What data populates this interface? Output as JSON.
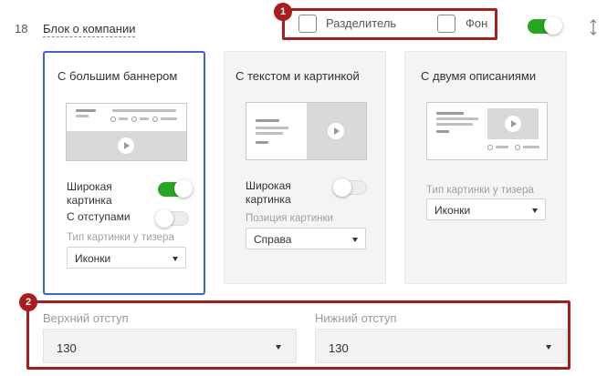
{
  "row": {
    "number": "18",
    "title": "Блок о компании"
  },
  "checkboxes": [
    {
      "label": "Разделитель",
      "checked": false
    },
    {
      "label": "Фон",
      "checked": false
    }
  ],
  "block_toggle": {
    "on": true
  },
  "cards": [
    {
      "title": "С большим баннером",
      "selected": true,
      "options": [
        {
          "label_line1": "Широкая",
          "label_line2": "картинка",
          "on": true
        },
        {
          "label_line1": "С отступами",
          "label_line2": "",
          "on": false
        }
      ],
      "select_label": "Тип картинки у тизера",
      "select_value": "Иконки"
    },
    {
      "title": "С текстом и картинкой",
      "selected": false,
      "options": [
        {
          "label_line1": "Широкая",
          "label_line2": "картинка",
          "on": false
        }
      ],
      "select_label": "Позиция картинки",
      "select_value": "Справа"
    },
    {
      "title": "С двумя описаниями",
      "selected": false,
      "options": [],
      "select_label": "Тип картинки у тизера",
      "select_value": "Иконки"
    }
  ],
  "padding": {
    "top": {
      "label": "Верхний отступ",
      "value": "130"
    },
    "bottom": {
      "label": "Нижний отступ",
      "value": "130"
    }
  },
  "callouts": [
    "1",
    "2"
  ],
  "colors": {
    "accent_green": "#27a71f",
    "selected_border": "#3f63c7",
    "callout_red": "#a81e1e"
  }
}
